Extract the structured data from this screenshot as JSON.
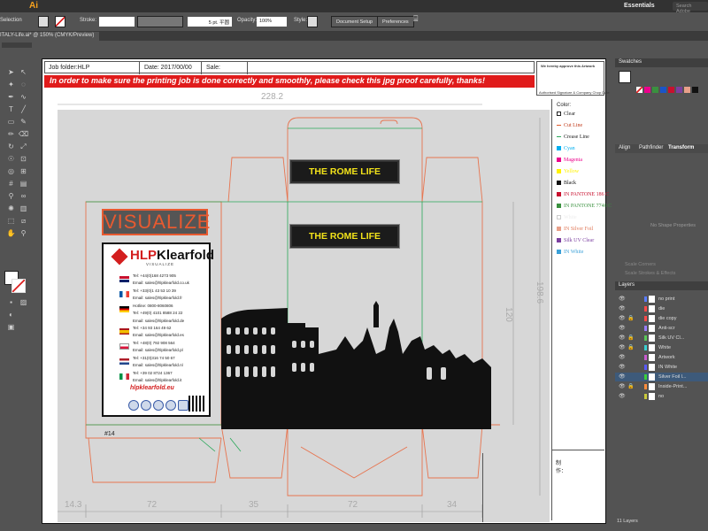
{
  "app": {
    "logo": "Ai",
    "workspace": "Essentials",
    "search_placeholder": "Search Adobe"
  },
  "control": {
    "selection_label": "Selection",
    "stroke_label": "Stroke:",
    "brush": "5 pt. 平圆",
    "opacity_label": "Opacity:",
    "opacity_value": "100%",
    "style_label": "Style:",
    "doc_setup": "Document Setup",
    "preferences": "Preferences"
  },
  "document": {
    "tab_title": "ITALY-Life.ai* @ 150% (CMYK/Preview)"
  },
  "job": {
    "folder": "Job folder:HLP",
    "date": "Date: 2017/00/00",
    "sale": "Sale:"
  },
  "banner": "In order to make sure the printing job is done correctly and smoothly, please check this jpg proof carefully, thanks!",
  "approval": {
    "title": "We hereby approve this Artwork",
    "footer": "Authorised Signature & Company Chop      Date"
  },
  "dims": {
    "top": "228.2",
    "right_outer": "198.6",
    "right_inner": "120",
    "b1": "14.3",
    "b2": "72",
    "b3": "35",
    "b4": "72",
    "b5": "34"
  },
  "legend": {
    "title": "Color:",
    "items": [
      {
        "label": "Clear",
        "color": "#ffffff"
      },
      {
        "label": "Cut Line",
        "color": "#e05a2b"
      },
      {
        "label": "Crease Line",
        "color": "#2aa85a"
      },
      {
        "label": "Cyan",
        "color": "#00aeef"
      },
      {
        "label": "Magenta",
        "color": "#ec008c"
      },
      {
        "label": "Yellow",
        "color": "#fff200"
      },
      {
        "label": "Black",
        "color": "#111111"
      },
      {
        "label": "IN PANTONE 186 C",
        "color": "#c8102e"
      },
      {
        "label": "IN PANTONE 7740 C",
        "color": "#3a913f"
      },
      {
        "label": "White",
        "color": "#ffffff"
      },
      {
        "label": "IN Silver Foil",
        "color": "#e8a08a"
      },
      {
        "label": "Silk UV Clear",
        "color": "#7b3fa0"
      },
      {
        "label": "IN White",
        "color": "#3aa0d8"
      }
    ]
  },
  "stamp": "制作：",
  "package": {
    "brand_box": "VISUALIZE",
    "logo_main": "HLP",
    "logo_rest": "Klearfold",
    "logo_sub": "VISUALIZE",
    "contacts": [
      {
        "country": "uk",
        "line1": "Tel: +44(0)168 4273 905",
        "line2": "Email: sales@hlpklearfold.co.uk"
      },
      {
        "country": "fr",
        "line1": "Tel: +33(0)1 43 53 10 39",
        "line2": "Email: sales@hlpklearfold.fr"
      },
      {
        "country": "de",
        "line1": "Hotline: 0800-8060806",
        "line2": "Tel: +49(0) 4101 8588 24 22"
      },
      {
        "country": "de2",
        "line1": "Email: sales@hlpklearfold.de",
        "line2": ""
      },
      {
        "country": "es",
        "line1": "Tel: +34 93 164 49 62",
        "line2": "Email: sales@hlpklearfold.es"
      },
      {
        "country": "pl",
        "line1": "Tel: +48(0) 792 908 564",
        "line2": "Email: sales@hlpklearfold.pl"
      },
      {
        "country": "nl",
        "line1": "Tel: +31(0)316 74 50 67",
        "line2": "Email: sales@hlpklearfold.nl"
      },
      {
        "country": "it",
        "line1": "Tel: +39 02 8724 1367",
        "line2": "Email: sales@hlpklearfold.it"
      }
    ],
    "website": "hlpklearfold.eu",
    "part_no": "#14",
    "title_top": "THE ROME LIFE",
    "title_front": "THE ROME LIFE"
  },
  "panels": {
    "swatches": "Swatches",
    "tabs": [
      "Align",
      "Pathfinder",
      "Transform"
    ],
    "no_shape": "No Shape Properties",
    "scale_corners": "Scale Corners",
    "scale_strokes": "Scale Strokes & Effects",
    "layers_title": "Layers",
    "layers": [
      {
        "name": "no print",
        "color": "#5a7cff"
      },
      {
        "name": "die",
        "color": "#ff4a4a"
      },
      {
        "name": "die copy",
        "color": "#ff4a4a"
      },
      {
        "name": "Anti-scr",
        "color": "#9a7cff"
      },
      {
        "name": "Silk UV Cl...",
        "color": "#5ac85a"
      },
      {
        "name": "White",
        "color": "#3ad0d0"
      },
      {
        "name": "Artwork",
        "color": "#c85ad0"
      },
      {
        "name": "IN White",
        "color": "#5a5aff"
      },
      {
        "name": "Silver Foil l...",
        "color": "#3ad03a"
      },
      {
        "name": "Inside-Print...",
        "color": "#ff8c3a"
      },
      {
        "name": "no",
        "color": "#c8c83a"
      }
    ],
    "layers_count": "11 Layers"
  }
}
